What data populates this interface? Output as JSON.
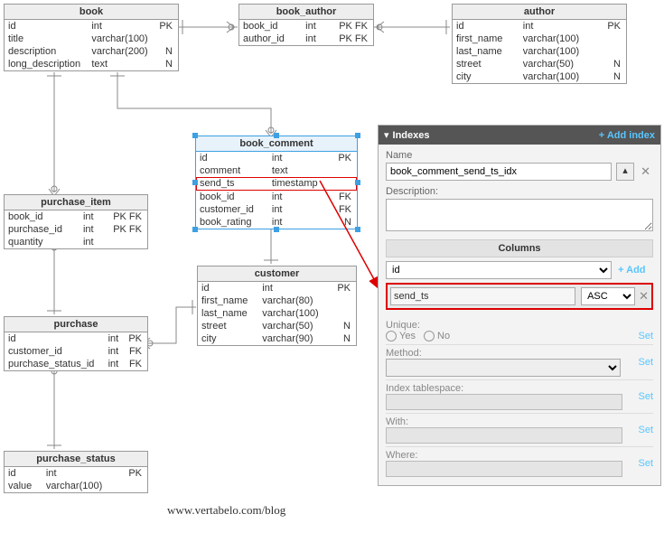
{
  "entities": {
    "book": {
      "title": "book",
      "cols": [
        {
          "n": "id",
          "t": "int",
          "f": "PK"
        },
        {
          "n": "title",
          "t": "varchar(100)",
          "f": ""
        },
        {
          "n": "description",
          "t": "varchar(200)",
          "f": "N"
        },
        {
          "n": "long_description",
          "t": "text",
          "f": "N"
        }
      ]
    },
    "book_author": {
      "title": "book_author",
      "cols": [
        {
          "n": "book_id",
          "t": "int",
          "f": "PK FK"
        },
        {
          "n": "author_id",
          "t": "int",
          "f": "PK FK"
        }
      ]
    },
    "author": {
      "title": "author",
      "cols": [
        {
          "n": "id",
          "t": "int",
          "f": "PK"
        },
        {
          "n": "first_name",
          "t": "varchar(100)",
          "f": ""
        },
        {
          "n": "last_name",
          "t": "varchar(100)",
          "f": ""
        },
        {
          "n": "street",
          "t": "varchar(50)",
          "f": "N"
        },
        {
          "n": "city",
          "t": "varchar(100)",
          "f": "N"
        }
      ]
    },
    "book_comment": {
      "title": "book_comment",
      "cols": [
        {
          "n": "id",
          "t": "int",
          "f": "PK"
        },
        {
          "n": "comment",
          "t": "text",
          "f": ""
        },
        {
          "n": "send_ts",
          "t": "timestamp",
          "f": ""
        },
        {
          "n": "book_id",
          "t": "int",
          "f": "FK"
        },
        {
          "n": "customer_id",
          "t": "int",
          "f": "FK"
        },
        {
          "n": "book_rating",
          "t": "int",
          "f": "N"
        }
      ]
    },
    "purchase_item": {
      "title": "purchase_item",
      "cols": [
        {
          "n": "book_id",
          "t": "int",
          "f": "PK FK"
        },
        {
          "n": "purchase_id",
          "t": "int",
          "f": "PK FK"
        },
        {
          "n": "quantity",
          "t": "int",
          "f": ""
        }
      ]
    },
    "customer": {
      "title": "customer",
      "cols": [
        {
          "n": "id",
          "t": "int",
          "f": "PK"
        },
        {
          "n": "first_name",
          "t": "varchar(80)",
          "f": ""
        },
        {
          "n": "last_name",
          "t": "varchar(100)",
          "f": ""
        },
        {
          "n": "street",
          "t": "varchar(50)",
          "f": "N"
        },
        {
          "n": "city",
          "t": "varchar(90)",
          "f": "N"
        }
      ]
    },
    "purchase": {
      "title": "purchase",
      "cols": [
        {
          "n": "id",
          "t": "int",
          "f": "PK"
        },
        {
          "n": "customer_id",
          "t": "int",
          "f": "FK"
        },
        {
          "n": "purchase_status_id",
          "t": "int",
          "f": "FK"
        }
      ]
    },
    "purchase_status": {
      "title": "purchase_status",
      "cols": [
        {
          "n": "id",
          "t": "int",
          "f": "PK"
        },
        {
          "n": "value",
          "t": "varchar(100)",
          "f": ""
        }
      ]
    }
  },
  "panel": {
    "header": "Indexes",
    "add_index": "+ Add index",
    "name_label": "Name",
    "name_value": "book_comment_send_ts_idx",
    "desc_label": "Description:",
    "columns_header": "Columns",
    "col_select": "id",
    "add_col": "+ Add",
    "selected_col": "send_ts",
    "order": "ASC",
    "unique": "Unique:",
    "yes": "Yes",
    "no": "No",
    "method": "Method:",
    "tablespace": "Index tablespace:",
    "with": "With:",
    "where": "Where:",
    "set": "Set"
  },
  "footer": "www.vertabelo.com/blog"
}
